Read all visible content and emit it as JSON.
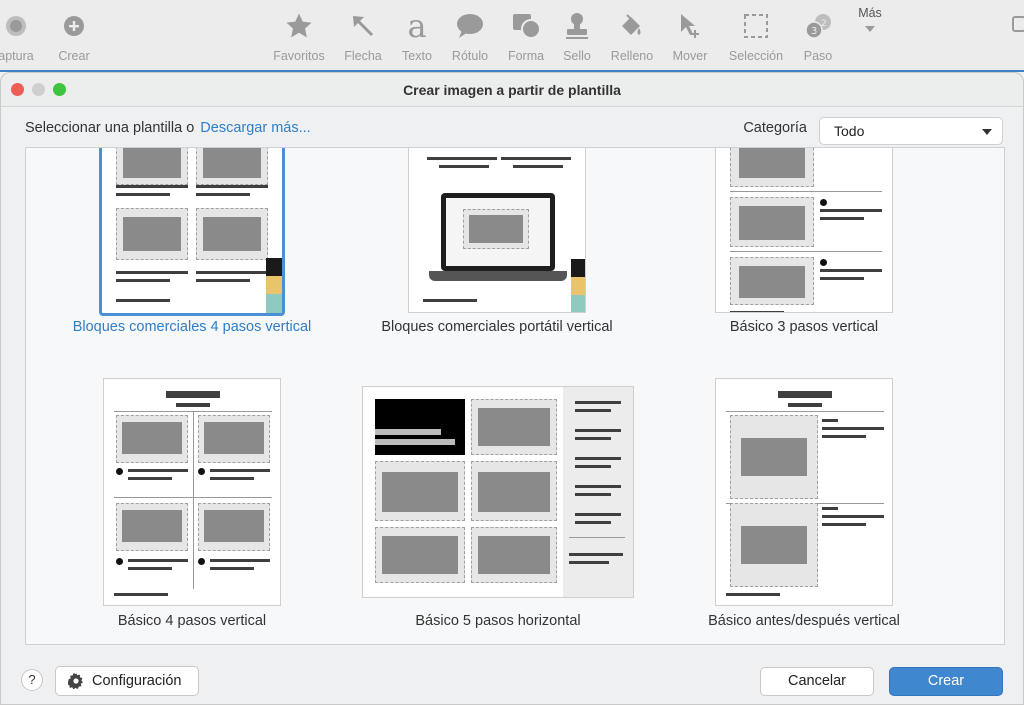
{
  "toolbar": {
    "items": [
      {
        "label": "aptura",
        "icon": "capture-icon"
      },
      {
        "label": "Crear",
        "icon": "plus-circle-icon"
      },
      {
        "label": "Favoritos",
        "icon": "star-icon"
      },
      {
        "label": "Flecha",
        "icon": "arrow-icon"
      },
      {
        "label": "Texto",
        "icon": "text-icon",
        "glyph": "a"
      },
      {
        "label": "Rótulo",
        "icon": "callout-icon"
      },
      {
        "label": "Forma",
        "icon": "shape-icon"
      },
      {
        "label": "Sello",
        "icon": "stamp-icon"
      },
      {
        "label": "Relleno",
        "icon": "fill-icon"
      },
      {
        "label": "Mover",
        "icon": "move-icon"
      },
      {
        "label": "Selección",
        "icon": "selection-icon"
      },
      {
        "label": "Paso",
        "icon": "step-icon"
      },
      {
        "label": "Más",
        "icon": "more-icon"
      }
    ]
  },
  "dialog": {
    "title": "Crear imagen a partir de plantilla",
    "select_prompt": "Seleccionar una plantilla o",
    "download_link": "Descargar más...",
    "category_label": "Categoría",
    "category_value": "Todo",
    "templates": [
      {
        "name": "Bloques comerciales 4 pasos vertical",
        "selected": true
      },
      {
        "name": "Bloques comerciales portátil vertical",
        "selected": false
      },
      {
        "name": "Básico 3 pasos vertical",
        "selected": false
      },
      {
        "name": "Básico 4 pasos vertical",
        "selected": false
      },
      {
        "name": "Básico 5 pasos horizontal",
        "selected": false
      },
      {
        "name": "Básico antes/después vertical",
        "selected": false
      }
    ],
    "footer": {
      "help_label": "?",
      "config_label": "Configuración",
      "cancel_label": "Cancelar",
      "create_label": "Crear"
    }
  },
  "colors": {
    "accent": "#3f87cf",
    "link": "#2f7ec6",
    "close": "#ee5e55",
    "minimize": "#cfcfcf",
    "maximize": "#3ec43e"
  }
}
